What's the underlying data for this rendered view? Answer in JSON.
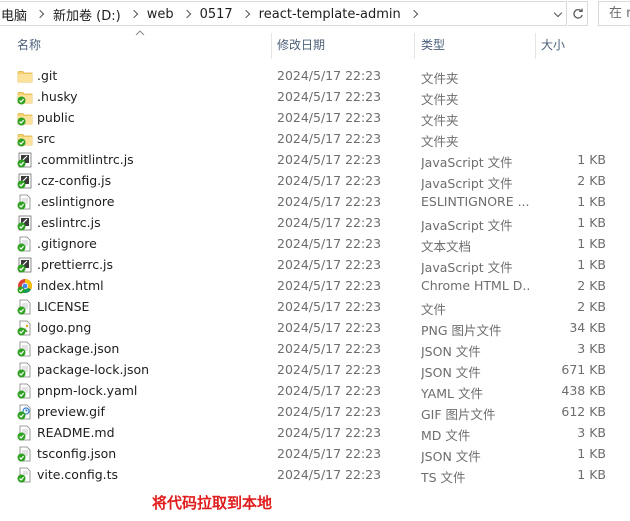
{
  "address_bar": {
    "crumbs": [
      "电脑",
      "新加卷 (D:)",
      "web",
      "0517",
      "react-template-admin"
    ]
  },
  "search": {
    "placeholder": "在 r"
  },
  "columns": {
    "name": "名称",
    "date": "修改日期",
    "type": "类型",
    "size": "大小"
  },
  "files": [
    {
      "name": ".git",
      "date": "2024/5/17 22:23",
      "type": "文件夹",
      "size": "",
      "icon": "folder-icon"
    },
    {
      "name": ".husky",
      "date": "2024/5/17 22:23",
      "type": "文件夹",
      "size": "",
      "icon": "folder-synced-icon"
    },
    {
      "name": "public",
      "date": "2024/5/17 22:23",
      "type": "文件夹",
      "size": "",
      "icon": "folder-synced-icon"
    },
    {
      "name": "src",
      "date": "2024/5/17 22:23",
      "type": "文件夹",
      "size": "",
      "icon": "folder-synced-icon"
    },
    {
      "name": ".commitlintrc.js",
      "date": "2024/5/17 22:23",
      "type": "JavaScript 文件",
      "size": "1 KB",
      "icon": "js-file-icon"
    },
    {
      "name": ".cz-config.js",
      "date": "2024/5/17 22:23",
      "type": "JavaScript 文件",
      "size": "2 KB",
      "icon": "js-file-icon"
    },
    {
      "name": ".eslintignore",
      "date": "2024/5/17 22:23",
      "type": "ESLINTIGNORE ...",
      "size": "1 KB",
      "icon": "text-file-icon"
    },
    {
      "name": ".eslintrc.js",
      "date": "2024/5/17 22:23",
      "type": "JavaScript 文件",
      "size": "1 KB",
      "icon": "js-file-icon"
    },
    {
      "name": ".gitignore",
      "date": "2024/5/17 22:23",
      "type": "文本文档",
      "size": "1 KB",
      "icon": "text-file-icon"
    },
    {
      "name": ".prettierrc.js",
      "date": "2024/5/17 22:23",
      "type": "JavaScript 文件",
      "size": "1 KB",
      "icon": "js-file-icon"
    },
    {
      "name": "index.html",
      "date": "2024/5/17 22:23",
      "type": "Chrome HTML D...",
      "size": "2 KB",
      "icon": "chrome-icon"
    },
    {
      "name": "LICENSE",
      "date": "2024/5/17 22:23",
      "type": "文件",
      "size": "2 KB",
      "icon": "text-file-icon"
    },
    {
      "name": "logo.png",
      "date": "2024/5/17 22:23",
      "type": "PNG 图片文件",
      "size": "34 KB",
      "icon": "image-file-icon"
    },
    {
      "name": "package.json",
      "date": "2024/5/17 22:23",
      "type": "JSON 文件",
      "size": "3 KB",
      "icon": "text-file-icon"
    },
    {
      "name": "package-lock.json",
      "date": "2024/5/17 22:23",
      "type": "JSON 文件",
      "size": "671 KB",
      "icon": "text-file-icon"
    },
    {
      "name": "pnpm-lock.yaml",
      "date": "2024/5/17 22:23",
      "type": "YAML 文件",
      "size": "438 KB",
      "icon": "text-file-icon"
    },
    {
      "name": "preview.gif",
      "date": "2024/5/17 22:23",
      "type": "GIF 图片文件",
      "size": "612 KB",
      "icon": "gif-file-icon"
    },
    {
      "name": "README.md",
      "date": "2024/5/17 22:23",
      "type": "MD 文件",
      "size": "3 KB",
      "icon": "text-file-icon"
    },
    {
      "name": "tsconfig.json",
      "date": "2024/5/17 22:23",
      "type": "JSON 文件",
      "size": "1 KB",
      "icon": "text-file-icon"
    },
    {
      "name": "vite.config.ts",
      "date": "2024/5/17 22:23",
      "type": "TS 文件",
      "size": "1 KB",
      "icon": "ts-file-icon"
    }
  ],
  "caption": "将代码拉取到本地",
  "colors": {
    "header_text": "#4c607a",
    "caption": "#e11c1c",
    "folder": "#f6d170",
    "sync_badge": "#2ea121"
  }
}
